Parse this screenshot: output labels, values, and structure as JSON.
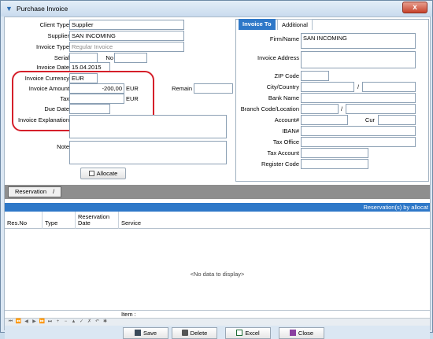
{
  "window": {
    "title": "Purchase Invoice",
    "close": "x"
  },
  "form": {
    "client_type_label": "Client Type",
    "client_type": "Supplier",
    "supplier_label": "Supplier",
    "supplier": "SAN INCOMING",
    "invoice_type_label": "Invoice Type",
    "invoice_type": "Regular Invoice",
    "serial_label": "Serial",
    "serial": "",
    "no_label": "No",
    "no": "",
    "invoice_date_label": "Invoice Date",
    "invoice_date": "15.04.2015",
    "currency_label": "Invoice Currency",
    "currency": "EUR",
    "amount_label": "Invoice Amount",
    "amount": "-200,00",
    "amount_unit": "EUR",
    "remain_label": "Remain",
    "remain": "",
    "tax_label": "Tax",
    "tax": "",
    "tax_unit": "EUR",
    "due_date_label": "Due Date",
    "due_date": "",
    "explanation_label": "Invoice Explanation",
    "explanation": "",
    "note_label": "Note",
    "note": "",
    "allocate_label": "Allocate"
  },
  "right_panel": {
    "tabs": [
      "Invoice To",
      "Additional"
    ],
    "firm_label": "Firm/Name",
    "firm": "SAN INCOMING",
    "address_label": "Invoice Address",
    "address": "",
    "zip_label": "ZIP Code",
    "zip": "",
    "city_label": "City/Country",
    "city": "",
    "country": "",
    "slash1": "/",
    "bank_label": "Bank Name",
    "bank": "",
    "branch_label": "Branch Code/Location",
    "branch": "",
    "location": "",
    "slash2": "/",
    "account_label": "Account#",
    "account": "",
    "cur_label": "Cur",
    "cur": "",
    "iban_label": "IBAN#",
    "iban": "",
    "tax_office_label": "Tax Office",
    "tax_office": "",
    "tax_account_label": "Tax Account",
    "tax_account": "",
    "register_label": "Register Code",
    "register": ""
  },
  "reservation": {
    "tab_label": "Reservation",
    "tab_mark": "/",
    "grid_caption": "Reservation(s) by allocat",
    "columns": [
      "Res.No",
      "Type",
      "Reservation Date",
      "Service"
    ],
    "empty_text": "<No data to display>",
    "footer_item_label": "Item :"
  },
  "nav_glyphs": [
    "⏮",
    "⏪",
    "◀",
    "▶",
    "⏩",
    "⏭",
    "+",
    "−",
    "▲",
    "✓",
    "✗",
    "↶",
    "✱"
  ],
  "toolbar": {
    "save": "Save",
    "delete": "Delete",
    "excel": "Excel",
    "close": "Close"
  },
  "colors": {
    "accent": "#2e78c8",
    "highlight_ring": "#d51f2a",
    "window_bg": "#dbe7f3"
  }
}
